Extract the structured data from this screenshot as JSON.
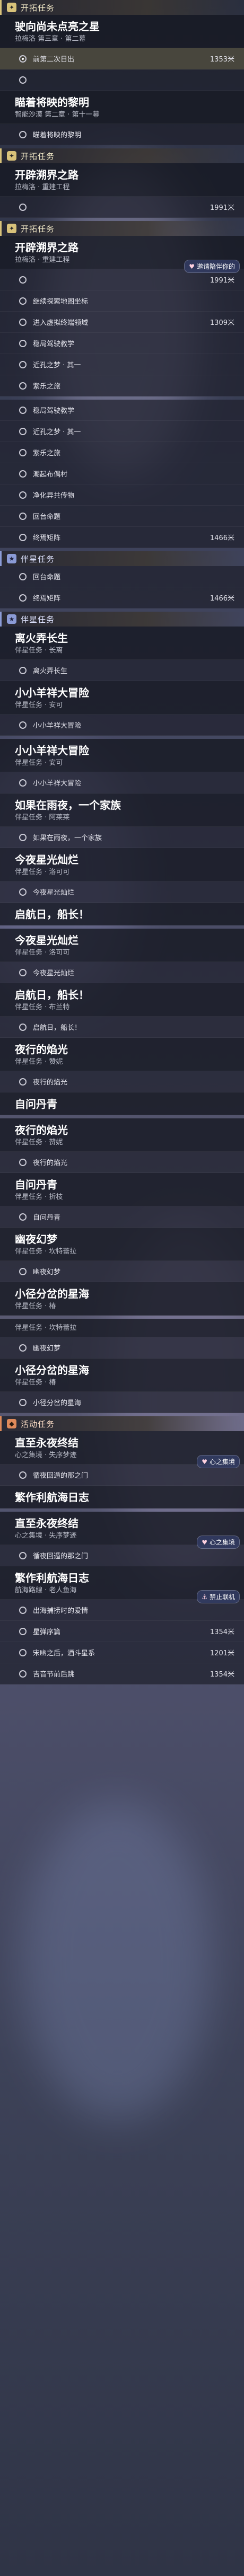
{
  "sections": [
    {
      "type": "trailblaze",
      "label": "开拓任务",
      "icon": "trailblaze-star-icon",
      "quests": [
        {
          "title": "驶向尚未点亮之星",
          "subtitle": "拉梅洛 第三章 · 第二幕",
          "steps": [
            {
              "text": "前第二次日出",
              "dist": "1353米",
              "active": true
            },
            {
              "text": "",
              "dist": "",
              "active": false
            }
          ]
        },
        {
          "title": "瞄着将映的黎明",
          "subtitle": "智能沙漠 第二章 · 第十一幕",
          "steps": [
            {
              "text": "瞄着将映的黎明",
              "dist": "",
              "active": false
            }
          ]
        }
      ]
    },
    {
      "type": "trailblaze",
      "label": "开拓任务",
      "icon": "trailblaze-star-icon",
      "quests": [
        {
          "title": "开辟溯界之路",
          "subtitle": "拉梅洛 · 重建工程",
          "steps": [
            {
              "text": "",
              "dist": "1991米",
              "active": false
            }
          ]
        }
      ]
    },
    {
      "type": "trailblaze",
      "label": "开拓任务",
      "icon": "trailblaze-star-icon",
      "quests": [
        {
          "title": "开辟溯界之路",
          "subtitle": "拉梅洛 · 重建工程",
          "steps": [
            {
              "text": "",
              "dist": "1991米",
              "active": false
            },
            {
              "text": "继续探索地图坐标",
              "dist": "",
              "active": false
            },
            {
              "text": "进入虚拟终端领域",
              "dist": "1309米",
              "active": false
            },
            {
              "text": "稳局驾驶教学",
              "dist": "",
              "active": false
            },
            {
              "text": "近孔之梦 · 其一",
              "dist": "",
              "active": false
            },
            {
              "text": "紫乐之旅",
              "dist": "",
              "active": false
            }
          ]
        }
      ]
    },
    {
      "type": "trailblaze",
      "label": "",
      "icon": "",
      "quests": [
        {
          "title": "",
          "subtitle": "",
          "steps": [
            {
              "text": "稳局驾驶教学",
              "dist": "",
              "active": false
            },
            {
              "text": "近孔之梦 · 其一",
              "dist": "",
              "active": false
            },
            {
              "text": "紫乐之旅",
              "dist": "",
              "active": false
            },
            {
              "text": "潮起布偶村",
              "dist": "",
              "active": false
            },
            {
              "text": "净化异共传物",
              "dist": "",
              "active": false
            },
            {
              "text": "回台命题",
              "dist": "",
              "active": false
            },
            {
              "text": "终焉矩阵",
              "dist": "1466米",
              "active": false
            }
          ]
        }
      ]
    },
    {
      "type": "side",
      "label": "伴星任务",
      "icon": "companion-star-icon",
      "quests": [
        {
          "title": "",
          "subtitle": "",
          "steps": [
            {
              "text": "回台命题",
              "dist": "",
              "active": false
            },
            {
              "text": "终焉矩阵",
              "dist": "1466米",
              "active": false
            }
          ]
        }
      ]
    },
    {
      "type": "side",
      "label": "伴星任务",
      "icon": "companion-star-icon",
      "quests": [
        {
          "title": "离火弄长生",
          "subtitle": "伴星任务 · 长离",
          "steps": [
            {
              "text": "离火弄长生",
              "dist": "",
              "active": false
            }
          ]
        },
        {
          "title": "小小羊祥大冒险",
          "subtitle": "伴星任务 · 安可",
          "steps": [
            {
              "text": "小小羊祥大冒险",
              "dist": "",
              "active": false
            }
          ]
        }
      ]
    },
    {
      "type": "side",
      "label": "",
      "icon": "",
      "quests": [
        {
          "title": "小小羊祥大冒险",
          "subtitle": "伴星任务 · 安可",
          "steps": [
            {
              "text": "小小羊祥大冒险",
              "dist": "",
              "active": false
            }
          ]
        },
        {
          "title": "如果在雨夜，一个家族",
          "subtitle": "伴星任务 · 阿莱莱",
          "steps": [
            {
              "text": "如果在雨夜，一个家族",
              "dist": "",
              "active": false
            }
          ]
        },
        {
          "title": "今夜星光灿烂",
          "subtitle": "伴星任务 · 洛可可",
          "steps": [
            {
              "text": "今夜星光灿烂",
              "dist": "",
              "active": false
            }
          ]
        },
        {
          "title": "启航日，船长！",
          "subtitle": "",
          "steps": []
        }
      ]
    },
    {
      "type": "side",
      "label": "",
      "icon": "",
      "quests": [
        {
          "title": "今夜星光灿烂",
          "subtitle": "伴星任务 · 洛可可",
          "steps": [
            {
              "text": "今夜星光灿烂",
              "dist": "",
              "active": false
            }
          ]
        },
        {
          "title": "启航日，船长！",
          "subtitle": "伴星任务 · 布兰特",
          "steps": [
            {
              "text": "启航日，船长！",
              "dist": "",
              "active": false
            }
          ]
        },
        {
          "title": "夜行的焰光",
          "subtitle": "伴星任务 · 赞妮",
          "steps": [
            {
              "text": "夜行的焰光",
              "dist": "",
              "active": false
            }
          ]
        },
        {
          "title": "自问丹青",
          "subtitle": "",
          "steps": []
        }
      ]
    },
    {
      "type": "side",
      "label": "",
      "icon": "",
      "quests": [
        {
          "title": "夜行的焰光",
          "subtitle": "伴星任务 · 赞妮",
          "steps": [
            {
              "text": "夜行的焰光",
              "dist": "",
              "active": false
            }
          ]
        },
        {
          "title": "自问丹青",
          "subtitle": "伴星任务 · 折枝",
          "steps": [
            {
              "text": "自问丹青",
              "dist": "",
              "active": false
            }
          ]
        },
        {
          "title": "幽夜幻梦",
          "subtitle": "伴星任务 · 坎特蕾拉",
          "steps": [
            {
              "text": "幽夜幻梦",
              "dist": "",
              "active": false
            }
          ]
        },
        {
          "title": "小径分岔的星海",
          "subtitle": "伴星任务 · 椿",
          "steps": []
        }
      ]
    },
    {
      "type": "side",
      "label": "",
      "icon": "",
      "quests": [
        {
          "title": "",
          "subtitle": "伴星任务 · 坎特蕾拉",
          "steps": [
            {
              "text": "幽夜幻梦",
              "dist": "",
              "active": false
            }
          ]
        },
        {
          "title": "小径分岔的星海",
          "subtitle": "伴星任务 · 椿",
          "steps": [
            {
              "text": "小径分岔的星海",
              "dist": "",
              "active": false
            }
          ]
        }
      ]
    },
    {
      "type": "event",
      "label": "活动任务",
      "icon": "event-icon",
      "quests": [
        {
          "title": "直至永夜终结",
          "subtitle": "心之集境 · 失序梦迹",
          "steps": [
            {
              "text": "循夜回遁的那之门",
              "dist": "",
              "active": false
            }
          ]
        },
        {
          "title": "繁作利航海日志",
          "subtitle": "",
          "steps": []
        }
      ]
    },
    {
      "type": "event",
      "label": "",
      "icon": "",
      "quests": [
        {
          "title": "直至永夜终结",
          "subtitle": "心之集境 · 失序梦迹",
          "steps": [
            {
              "text": "循夜回遁的那之门",
              "dist": "",
              "active": false
            }
          ]
        },
        {
          "title": "繁作利航海日志",
          "subtitle": "航海路線 · 老人鱼海",
          "steps": [
            {
              "text": "出海捕捞时的爱情",
              "dist": "",
              "active": false
            },
            {
              "text": "星弹序篇",
              "dist": "1354米",
              "active": false
            },
            {
              "text": "宋幽之后，酒斗星系",
              "dist": "1201米",
              "active": false
            },
            {
              "text": "吉音节前后跳",
              "dist": "1354米",
              "active": false
            }
          ]
        }
      ]
    }
  ],
  "float_badges": [
    {
      "icon": "heart-icon",
      "text": "邀请陪伴你的"
    },
    {
      "icon": "heart-icon",
      "text": "心之集境"
    },
    {
      "icon": "heart-icon",
      "text": "心之集境"
    },
    {
      "icon": "ship-icon",
      "text": "禁止联机"
    }
  ]
}
